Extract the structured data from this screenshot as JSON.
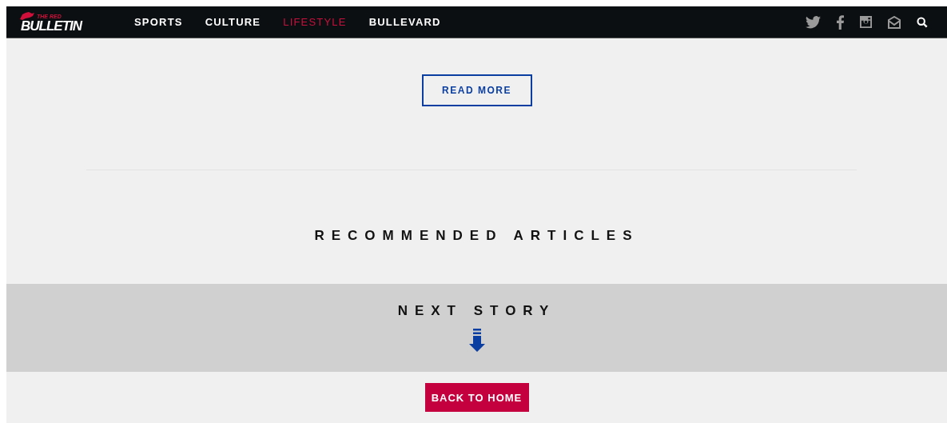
{
  "header": {
    "logo": {
      "small": "THE RED",
      "main": "BULLETIN"
    },
    "nav": [
      {
        "label": "SPORTS",
        "selected": false
      },
      {
        "label": "CULTURE",
        "selected": false
      },
      {
        "label": "LIFESTYLE",
        "selected": true
      },
      {
        "label": "BULLEVARD",
        "selected": false
      }
    ],
    "icons": [
      {
        "kind": "twitter"
      },
      {
        "kind": "facebook"
      },
      {
        "kind": "instagram"
      },
      {
        "kind": "mail"
      },
      {
        "kind": "search"
      }
    ]
  },
  "read_more": "READ MORE",
  "recommended_heading": "RECOMMENDED ARTICLES",
  "next_story": {
    "label": "NEXT STORY"
  },
  "back_to_home": "BACK TO HOME"
}
